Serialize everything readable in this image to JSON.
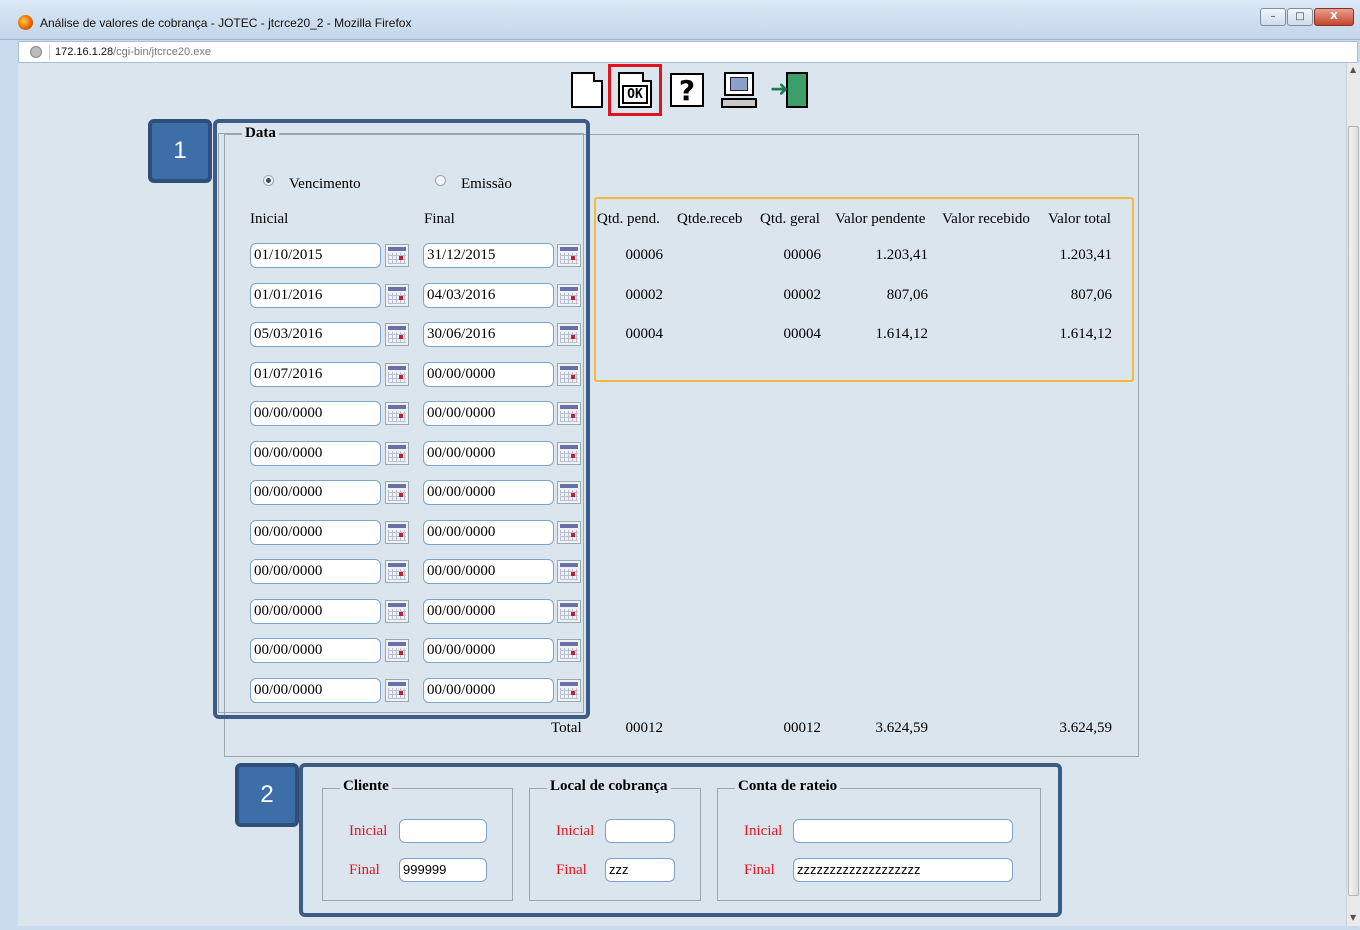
{
  "window": {
    "title": "Análise de valores de cobrança - JOTEC - jtcrce20_2 - Mozilla Firefox",
    "controls": [
      "–",
      "□",
      "X"
    ]
  },
  "urlbar": {
    "host": "172.16.1.28",
    "path": "/cgi-bin/jtcrce20.exe"
  },
  "toolbar": {
    "icons": [
      "new-document-icon",
      "ok-document-icon",
      "help-icon",
      "computer-report-icon",
      "exit-door-icon"
    ],
    "ok_label": "OK",
    "help_glyph": "?"
  },
  "data_section": {
    "legend": "Data",
    "radio_vencimento": "Vencimento",
    "radio_emissao": "Emissão",
    "selected": "Vencimento",
    "col_inicial": "Inicial",
    "col_final": "Final",
    "rows": [
      {
        "inicial": "01/10/2015",
        "final": "31/12/2015"
      },
      {
        "inicial": "01/01/2016",
        "final": "04/03/2016"
      },
      {
        "inicial": "05/03/2016",
        "final": "30/06/2016"
      },
      {
        "inicial": "01/07/2016",
        "final": "00/00/0000"
      },
      {
        "inicial": "00/00/0000",
        "final": "00/00/0000"
      },
      {
        "inicial": "00/00/0000",
        "final": "00/00/0000"
      },
      {
        "inicial": "00/00/0000",
        "final": "00/00/0000"
      },
      {
        "inicial": "00/00/0000",
        "final": "00/00/0000"
      },
      {
        "inicial": "00/00/0000",
        "final": "00/00/0000"
      },
      {
        "inicial": "00/00/0000",
        "final": "00/00/0000"
      },
      {
        "inicial": "00/00/0000",
        "final": "00/00/0000"
      },
      {
        "inicial": "00/00/0000",
        "final": "00/00/0000"
      }
    ]
  },
  "results": {
    "headers": [
      "Qtd. pend.",
      "Qtde.receb",
      "Qtd. geral",
      "Valor pendente",
      "Valor recebido",
      "Valor total"
    ],
    "rows": [
      {
        "qtd_pend": "00006",
        "qtde_receb": "",
        "qtd_geral": "00006",
        "valor_pendente": "1.203,41",
        "valor_recebido": "",
        "valor_total": "1.203,41"
      },
      {
        "qtd_pend": "00002",
        "qtde_receb": "",
        "qtd_geral": "00002",
        "valor_pendente": "807,06",
        "valor_recebido": "",
        "valor_total": "807,06"
      },
      {
        "qtd_pend": "00004",
        "qtde_receb": "",
        "qtd_geral": "00004",
        "valor_pendente": "1.614,12",
        "valor_recebido": "",
        "valor_total": "1.614,12"
      }
    ],
    "total_label": "Total",
    "total": {
      "qtd_pend": "00012",
      "qtd_geral": "00012",
      "valor_pendente": "3.624,59",
      "valor_total": "3.624,59"
    }
  },
  "filters": {
    "cliente": {
      "legend": "Cliente",
      "inicial_label": "Inicial",
      "final_label": "Final",
      "inicial": "",
      "final": "999999"
    },
    "local": {
      "legend": "Local de cobrança",
      "inicial_label": "Inicial",
      "final_label": "Final",
      "inicial": "",
      "final": "zzz"
    },
    "conta": {
      "legend": "Conta de rateio",
      "inicial_label": "Inicial",
      "final_label": "Final",
      "inicial": "",
      "final": "zzzzzzzzzzzzzzzzzzz"
    }
  },
  "annotations": {
    "badge1": "1",
    "badge2": "2"
  },
  "colors": {
    "highlight_red": "#e0141e",
    "annotation_blue": "#3c5b85",
    "annotation_yellow": "#f3b83c",
    "label_red": "#e0141e"
  }
}
